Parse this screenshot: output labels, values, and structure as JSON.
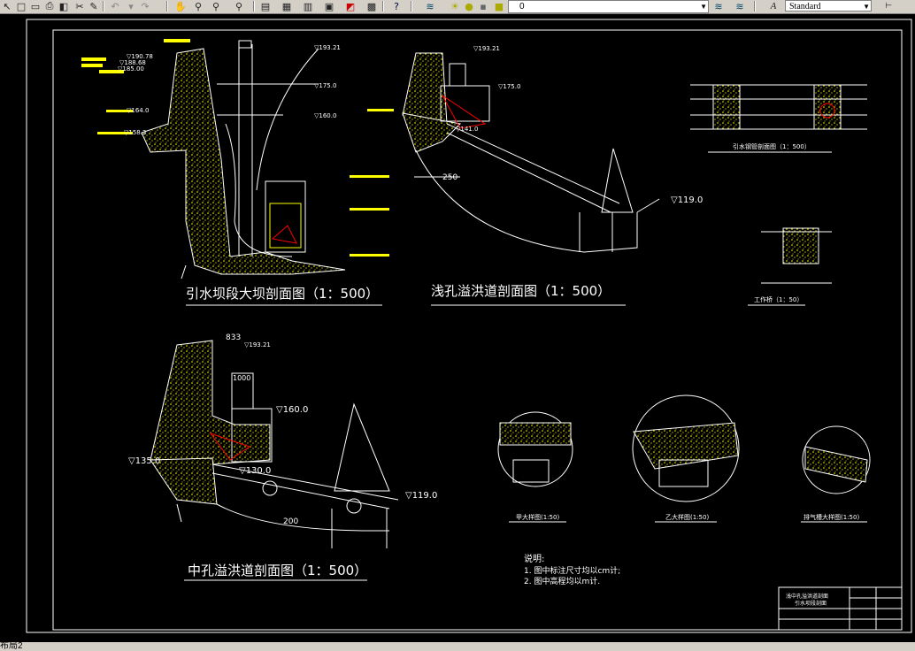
{
  "toolbar": {
    "layer_value": "0",
    "text_style_value": "Standard",
    "icons": [
      "pointer-icon",
      "new-icon",
      "open-icon",
      "print-icon",
      "preview-icon",
      "cut-icon",
      "undo-icon",
      "redo-icon",
      "pan-icon",
      "zoom-realtime-icon",
      "zoom-window-icon",
      "zoom-previous-icon",
      "properties-icon",
      "design-center-icon",
      "tool-palette-icon",
      "sheet-set-icon",
      "markup-icon",
      "quickcalc-icon",
      "help-icon",
      "layers-icon",
      "layer-on-icon",
      "freeze-icon",
      "lock-icon",
      "color-icon",
      "text-style-icon"
    ]
  },
  "status": {
    "tab_label": "布局2"
  },
  "drawing": {
    "views": [
      {
        "title": "引水坝段大坝剖面图（1：500）"
      },
      {
        "title": "浅孔溢洪道剖面图（1：500）"
      },
      {
        "title": "中孔溢洪道剖面图（1：500）"
      },
      {
        "title": "引水钢管剖面图（1：500）"
      },
      {
        "title": "工作桥（1：50）"
      },
      {
        "title": "甲大样图(1:50)"
      },
      {
        "title": "乙大样图(1:50)"
      },
      {
        "title": "排气槽大样图(1:50)"
      }
    ],
    "labels": {
      "dim_833": "833",
      "dim_1000": "1000",
      "dim_250": "250",
      "dim_200": "200",
      "elev_193_21": "▽193.21",
      "elev_193_21b": "▽193.21",
      "elev_193_21c": "▽193.21",
      "elev_175": "▽175.0",
      "elev_175b": "▽175.0",
      "elev_160": "▽160.0",
      "elev_160b": "▽160.0",
      "elev_164": "▽164.0",
      "elev_158": "▽158.3",
      "elev_135": "▽135.0",
      "elev_130": "▽130.0",
      "elev_119a": "▽119.0",
      "elev_119b": "▽119.0",
      "elev_190": "▽190.78",
      "elev_188": "▽188.68",
      "elev_185": "▽185.00",
      "elev_141": "▽141.0"
    },
    "notes": {
      "heading": "说明:",
      "line1": "1. 图中标注尺寸均以cm计;",
      "line2": "2. 图中高程均以m计."
    },
    "title_block": {
      "line1": "浅中孔溢洪道剖面",
      "line2": "引水坝段剖面"
    }
  },
  "colors": {
    "background": "#000000",
    "line": "#ffffff",
    "concrete": "#ffff00",
    "gate": "#ff0000",
    "toolbar": "#d4d0c8"
  }
}
